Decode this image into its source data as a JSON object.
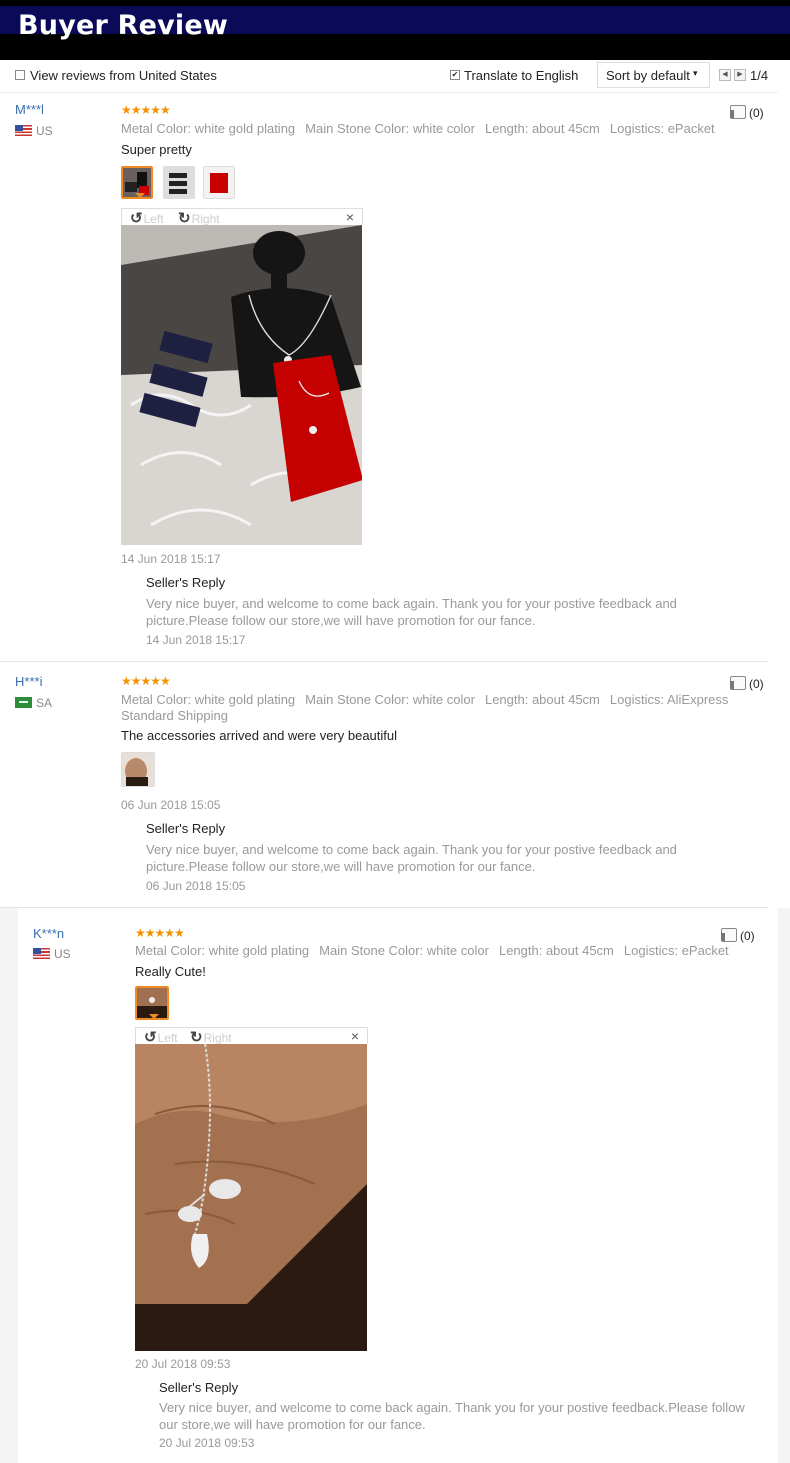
{
  "banner": {
    "title": "Buyer Review"
  },
  "toolbar": {
    "view_us_label": "View reviews from United States",
    "translate_label": "Translate to English",
    "sort_label": "Sort by default",
    "page_indicator": "1/4"
  },
  "reviews": [
    {
      "user": "M***l",
      "country": "US",
      "rating": 5,
      "attrs": [
        "Metal Color: white gold plating",
        "Main Stone Color: white color",
        "Length: about 45cm",
        "Logistics: ePacket"
      ],
      "text": "Super pretty",
      "likes": "(0)",
      "date": "14 Jun 2018 15:17",
      "photos": 3,
      "seller_reply_label": "Seller's Reply",
      "reply": "Very nice buyer, and welcome to come back again. Thank you for your postive feedback and picture.Please follow our store,we will have promotion for our fance.",
      "reply_date": "14 Jun 2018 15:17",
      "viewer": {
        "left": "Left",
        "right": "Right",
        "close": "×"
      }
    },
    {
      "user": "H***i",
      "country": "SA",
      "rating": 5,
      "attrs": [
        "Metal Color: white gold plating",
        "Main Stone Color: white color",
        "Length: about 45cm",
        "Logistics: AliExpress Standard Shipping"
      ],
      "text": "The accessories arrived and were very beautiful",
      "likes": "(0)",
      "date": "06 Jun 2018 15:05",
      "photos": 1,
      "seller_reply_label": "Seller's Reply",
      "reply": "Very nice buyer, and welcome to come back again. Thank you for your postive feedback and picture.Please follow our store,we will have promotion for our fance.",
      "reply_date": "06 Jun 2018 15:05"
    },
    {
      "user": "K***n",
      "country": "US",
      "rating": 5,
      "attrs": [
        "Metal Color: white gold plating",
        "Main Stone Color: white color",
        "Length: about 45cm",
        "Logistics: ePacket"
      ],
      "text": "Really Cute!",
      "likes": "(0)",
      "date": "20 Jul 2018 09:53",
      "photos": 1,
      "seller_reply_label": "Seller's Reply",
      "reply": "Very nice buyer, and welcome to come back again. Thank you for your postive feedback.Please follow our store,we will have promotion for our fance.",
      "reply_date": "20 Jul 2018 09:53",
      "viewer": {
        "left": "Left",
        "right": "Right",
        "close": "×"
      }
    }
  ],
  "icons": {
    "star": "★",
    "thumbs_up": "thumbs-up-icon",
    "rotate_left": "rotate-left-icon",
    "rotate_right": "rotate-right-icon"
  },
  "colors": {
    "banner_bg": "#000000",
    "banner_band": "#0a0a58",
    "link_blue": "#3a6fb0",
    "star_orange": "#f39300",
    "thumb_selected": "#f08a24"
  }
}
